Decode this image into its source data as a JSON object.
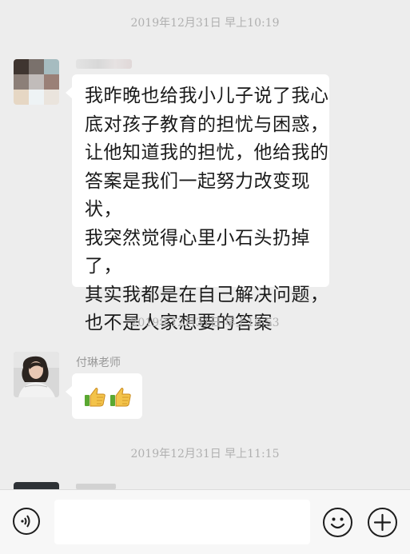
{
  "messages": {
    "timestamp1": "2019年12月31日 早上10:19",
    "timestamp2": "2019年12月31日 早上10:53",
    "timestamp3": "2019年12月31日 早上11:15",
    "msg1_text": "我昨晚也给我小儿子说了我心\n底对孩子教育的担忧与困惑，\n让他知道我的担忧，他给我的\n答案是我们一起努力改变现状，\n我突然觉得心里小石头扔掉了，\n其实我都是在自己解决问题，\n也不是人家想要的答案",
    "sender2_name": "付琳老师",
    "msg2_icons": [
      "thumbs-up-icon",
      "thumbs-up-icon"
    ]
  },
  "input": {
    "value": ""
  }
}
